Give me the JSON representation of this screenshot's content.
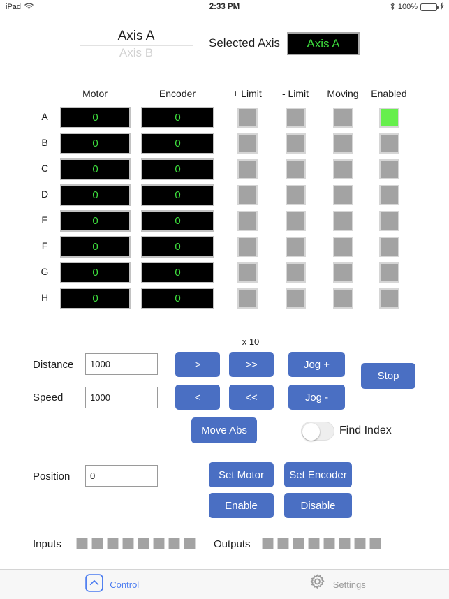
{
  "statusbar": {
    "device": "iPad",
    "wifi_icon": "wifi-icon",
    "time": "2:33 PM",
    "bluetooth_icon": "bluetooth-icon",
    "battery_percent": "100%",
    "battery_icon": "battery-charging-icon"
  },
  "picker": {
    "selected": "Axis A",
    "next": "Axis B"
  },
  "selected_axis": {
    "label": "Selected Axis",
    "value": "Axis A",
    "text_color": "#3ddd3d",
    "bg_color": "#000000"
  },
  "table": {
    "headers": [
      "Motor",
      "Encoder",
      "+ Limit",
      "- Limit",
      "Moving",
      "Enabled"
    ],
    "rows": [
      {
        "label": "A",
        "motor": "0",
        "encoder": "0",
        "plus_limit": false,
        "minus_limit": false,
        "moving": false,
        "enabled": true
      },
      {
        "label": "B",
        "motor": "0",
        "encoder": "0",
        "plus_limit": false,
        "minus_limit": false,
        "moving": false,
        "enabled": false
      },
      {
        "label": "C",
        "motor": "0",
        "encoder": "0",
        "plus_limit": false,
        "minus_limit": false,
        "moving": false,
        "enabled": false
      },
      {
        "label": "D",
        "motor": "0",
        "encoder": "0",
        "plus_limit": false,
        "minus_limit": false,
        "moving": false,
        "enabled": false
      },
      {
        "label": "E",
        "motor": "0",
        "encoder": "0",
        "plus_limit": false,
        "minus_limit": false,
        "moving": false,
        "enabled": false
      },
      {
        "label": "F",
        "motor": "0",
        "encoder": "0",
        "plus_limit": false,
        "minus_limit": false,
        "moving": false,
        "enabled": false
      },
      {
        "label": "G",
        "motor": "0",
        "encoder": "0",
        "plus_limit": false,
        "minus_limit": false,
        "moving": false,
        "enabled": false
      },
      {
        "label": "H",
        "motor": "0",
        "encoder": "0",
        "plus_limit": false,
        "minus_limit": false,
        "moving": false,
        "enabled": false
      }
    ],
    "indicator_on_color": "#66ef4c",
    "indicator_off_color": "#a3a3a3"
  },
  "controls": {
    "distance_label": "Distance",
    "distance_value": "1000",
    "speed_label": "Speed",
    "speed_value": "1000",
    "position_label": "Position",
    "position_value": "0",
    "multiplier_label": "x 10",
    "step_forward": ">",
    "step_forward_fast": ">>",
    "step_back": "<",
    "step_back_fast": "<<",
    "jog_plus": "Jog +",
    "jog_minus": "Jog -",
    "stop": "Stop",
    "move_abs": "Move Abs",
    "set_motor": "Set Motor",
    "set_encoder": "Set Encoder",
    "enable": "Enable",
    "disable": "Disable",
    "find_index_label": "Find Index",
    "find_index_on": false,
    "button_color": "#4a6fc3"
  },
  "io": {
    "inputs_label": "Inputs",
    "inputs": [
      false,
      false,
      false,
      false,
      false,
      false,
      false,
      false
    ],
    "outputs_label": "Outputs",
    "outputs": [
      false,
      false,
      false,
      false,
      false,
      false,
      false,
      false
    ]
  },
  "tabbar": {
    "tabs": [
      {
        "label": "Control",
        "icon": "control-chevron-up-icon",
        "active": true
      },
      {
        "label": "Settings",
        "icon": "gear-icon",
        "active": false
      }
    ],
    "active_color": "#4b7cf0",
    "inactive_color": "#9b9b9b"
  }
}
